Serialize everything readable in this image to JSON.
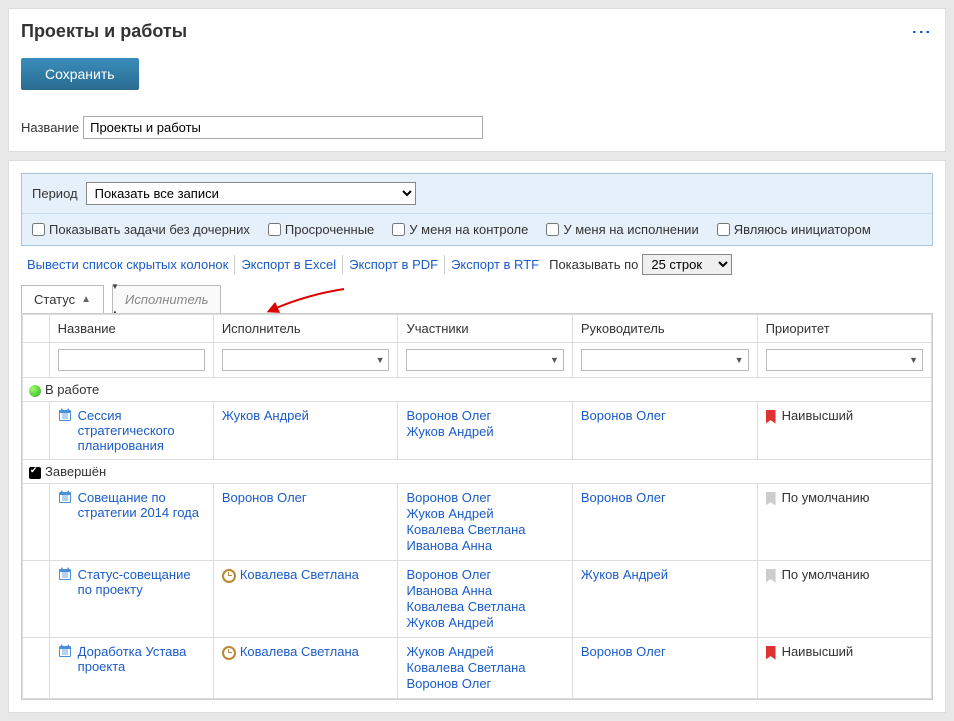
{
  "header": {
    "title": "Проекты и работы",
    "save_label": "Сохранить",
    "name_label": "Название",
    "name_value": "Проекты и работы"
  },
  "filters": {
    "period_label": "Период",
    "period_value": "Показать все записи",
    "chk_no_children": "Показывать задачи без дочерних",
    "chk_overdue": "Просроченные",
    "chk_control": "У меня на контроле",
    "chk_assignee": "У меня на исполнении",
    "chk_initiator": "Являюсь инициатором"
  },
  "actions": {
    "show_hidden": "Вывести список скрытых колонок",
    "export_excel": "Экспорт в Excel",
    "export_pdf": "Экспорт в PDF",
    "export_rtf": "Экспорт в RTF",
    "show_per": "Показывать по",
    "page_value": "25 строк"
  },
  "grouping": {
    "active_field": "Статус",
    "placeholder": "Исполнитель"
  },
  "columns": {
    "name": "Название",
    "executor": "Исполнитель",
    "participants": "Участники",
    "manager": "Руководитель",
    "priority": "Приоритет"
  },
  "groups": {
    "in_work": "В работе",
    "done": "Завершён"
  },
  "rows": [
    {
      "group": "in_work",
      "icon": "calendar",
      "name": "Сессия стратегического планирования",
      "executor": "Жуков Андрей",
      "participants": [
        "Воронов Олег",
        "Жуков Андрей"
      ],
      "manager": "Воронов Олег",
      "priority_icon": "red",
      "priority": "Наивысший"
    },
    {
      "group": "done",
      "icon": "calendar",
      "name": "Совещание по стратегии 2014 года",
      "executor": "Воронов Олег",
      "participants": [
        "Воронов Олег",
        "Жуков Андрей",
        "Ковалева Светлана",
        "Иванова Анна"
      ],
      "manager": "Воронов Олег",
      "priority_icon": "gray",
      "priority": "По умолчанию"
    },
    {
      "group": "done",
      "icon": "calendar",
      "name": "Статус-совещание по проекту",
      "executor_icon": "clock",
      "executor": "Ковалева Светлана",
      "participants": [
        "Воронов Олег",
        "Иванова Анна",
        "Ковалева Светлана",
        "Жуков Андрей"
      ],
      "manager": "Жуков Андрей",
      "priority_icon": "gray",
      "priority": "По умолчанию"
    },
    {
      "group": "done",
      "icon": "calendar",
      "name": "Доработка Устава проекта",
      "executor_icon": "clock",
      "executor": "Ковалева Светлана",
      "participants": [
        "Жуков Андрей",
        "Ковалева Светлана",
        "Воронов Олег"
      ],
      "manager": "Воронов Олег",
      "priority_icon": "red",
      "priority": "Наивысший"
    }
  ]
}
